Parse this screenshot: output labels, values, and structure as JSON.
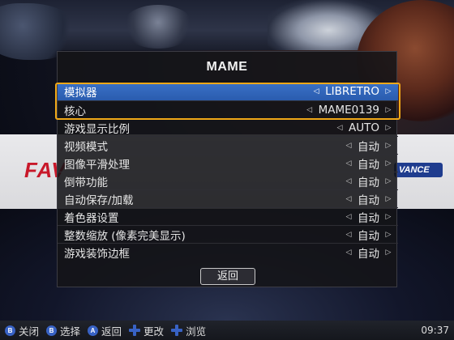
{
  "background": {
    "logo_left": "FAV",
    "logo_right": "VANCE"
  },
  "menu": {
    "title": "MAME",
    "items": [
      {
        "label": "模拟器",
        "value": "LIBRETRO"
      },
      {
        "label": "核心",
        "value": "MAME0139"
      },
      {
        "label": "游戏显示比例",
        "value": "AUTO"
      },
      {
        "label": "视频模式",
        "value": "自动"
      },
      {
        "label": "图像平滑处理",
        "value": "自动"
      },
      {
        "label": "倒带功能",
        "value": "自动"
      },
      {
        "label": "自动保存/加载",
        "value": "自动"
      },
      {
        "label": "着色器设置",
        "value": "自动"
      },
      {
        "label": "整数缩放 (像素完美显示)",
        "value": "自动"
      },
      {
        "label": "游戏装饰边框",
        "value": "自动"
      }
    ],
    "selected_index": 0,
    "back_label": "返回",
    "arrow_left": "◁",
    "arrow_right": "▷"
  },
  "help_bar": {
    "items": [
      {
        "icon": "b-button-icon",
        "glyph": "B",
        "label": "关闭"
      },
      {
        "icon": "b-button-icon",
        "glyph": "B",
        "label": "选择"
      },
      {
        "icon": "a-button-icon",
        "glyph": "A",
        "label": "返回"
      },
      {
        "icon": "dpad-icon",
        "glyph": "",
        "label": "更改"
      },
      {
        "icon": "dpad-icon",
        "glyph": "",
        "label": "浏览"
      }
    ],
    "clock": "09:37"
  },
  "colors": {
    "selection": "#2a5cae",
    "focus_frame": "#f0a818",
    "button_icon": "#3862c4"
  }
}
